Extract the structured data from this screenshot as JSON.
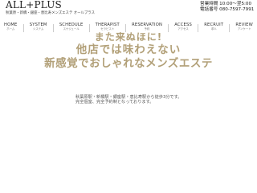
{
  "header": {
    "logo": "ALL+PLUS",
    "tagline": "秋葉原・新橋・銀座・恵比寿メンズエステ オールプラス",
    "hours": "営業時間 10:00〜翌5:00",
    "phone": "電話番号 080-7597-7991"
  },
  "nav": {
    "items": [
      {
        "en": "HOME",
        "jp": "ホーム"
      },
      {
        "en": "SYSTEM",
        "jp": "システム"
      },
      {
        "en": "SCHEDULE",
        "jp": "スケジュール"
      },
      {
        "en": "THERAPIST",
        "jp": "セラピスト"
      },
      {
        "en": "RESERVATION",
        "jp": "予約"
      },
      {
        "en": "ACCESS",
        "jp": "アクセス"
      },
      {
        "en": "RECRUIT",
        "jp": "求人"
      },
      {
        "en": "REVIEW",
        "jp": "アンケート"
      }
    ]
  },
  "hero": {
    "line1": "また来ぬほに!",
    "line2": "他店では味わえない",
    "line3": "新感覚でおしゃれなメンズエステ"
  },
  "access": {
    "line1": "秋葉原駅・新橋駅・銀座駅・恵比寿駅から徒歩3分です。",
    "line2": "完全個室、完全予約制となっております。"
  },
  "colors": {
    "hero_gold": "#b2a078",
    "text": "#333333",
    "background": "#ffffff"
  }
}
